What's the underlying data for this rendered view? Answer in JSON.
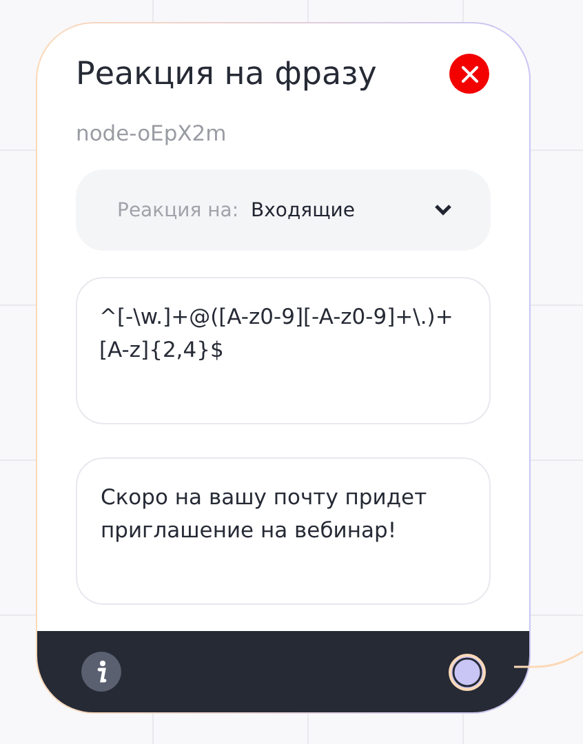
{
  "node": {
    "title": "Реакция на фразу",
    "id": "node-oEpX2m",
    "reaction": {
      "label": "Реакция на:",
      "value": "Входящие"
    },
    "pattern": "^[-\\w.]+@([A-z0-9][-A-z0-9]+\\.)+[A-z]{2,4}$",
    "reply": "Скоро на вашу почту придет приглашение на вебинар!"
  }
}
